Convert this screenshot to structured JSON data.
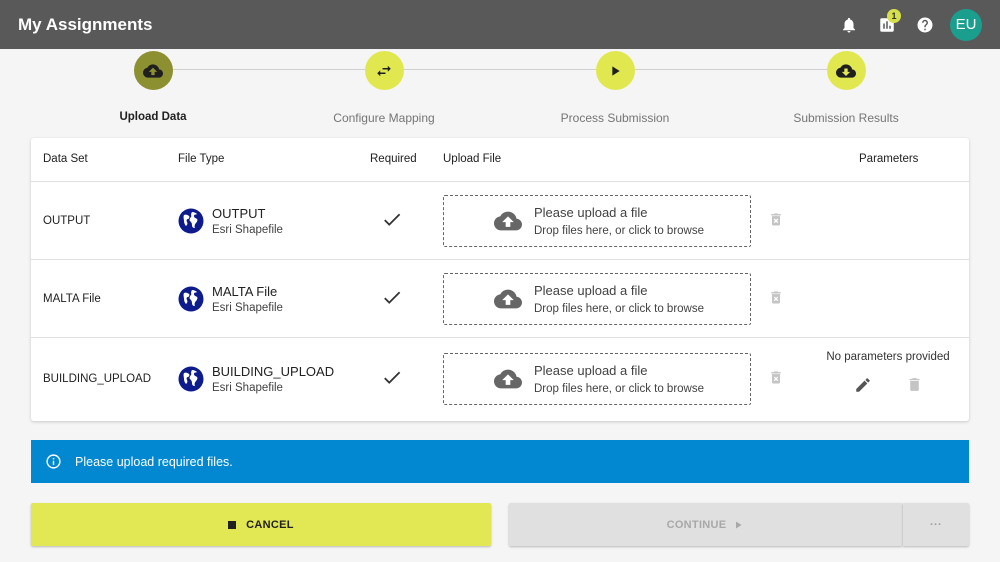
{
  "appbar": {
    "title": "My Assignments",
    "badge_count": "1",
    "avatar_initials": "EU",
    "icons": [
      "bell-icon",
      "chart-icon",
      "help-icon"
    ]
  },
  "stepper": {
    "steps": [
      {
        "label": "Upload Data",
        "icon": "cloud-upload-icon",
        "active": true
      },
      {
        "label": "Configure Mapping",
        "icon": "swap-icon",
        "active": false
      },
      {
        "label": "Process Submission",
        "icon": "play-icon",
        "active": false
      },
      {
        "label": "Submission Results",
        "icon": "cloud-download-icon",
        "active": false
      }
    ]
  },
  "table": {
    "headers": {
      "data_set": "Data Set",
      "file_type": "File Type",
      "required": "Required",
      "upload_file": "Upload File",
      "parameters": "Parameters"
    },
    "rows": [
      {
        "data_set": "OUTPUT",
        "file_name": "OUTPUT",
        "file_type": "Esri Shapefile",
        "required": true,
        "upload_title": "Please upload a file",
        "upload_sub": "Drop files here, or click to browse",
        "parameters": ""
      },
      {
        "data_set": "MALTA File",
        "file_name": "MALTA File",
        "file_type": "Esri Shapefile",
        "required": true,
        "upload_title": "Please upload a file",
        "upload_sub": "Drop files here, or click to browse",
        "parameters": ""
      },
      {
        "data_set": "BUILDING_UPLOAD",
        "file_name": "BUILDING_UPLOAD",
        "file_type": "Esri Shapefile",
        "required": true,
        "upload_title": "Please upload a file",
        "upload_sub": "Drop files here, or click to browse",
        "parameters": "No parameters provided"
      }
    ]
  },
  "alert": {
    "message": "Please upload required files.",
    "color": "#0288d1"
  },
  "footer": {
    "cancel_label": "CANCEL",
    "continue_label": "CONTINUE",
    "more_label": "···"
  },
  "colors": {
    "accent": "#e2e853",
    "appbar": "#595959",
    "avatar": "#1a9e8e",
    "active_step": "#8c9031"
  }
}
